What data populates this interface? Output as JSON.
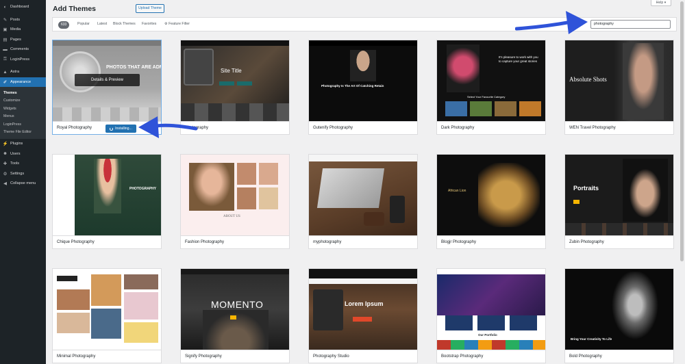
{
  "sidebar": {
    "items": [
      {
        "label": "Dashboard",
        "icon": "dashboard-icon",
        "glyph": "◐"
      },
      {
        "label": "Posts",
        "icon": "pin-icon",
        "glyph": "✎"
      },
      {
        "label": "Media",
        "icon": "media-icon",
        "glyph": "▣"
      },
      {
        "label": "Pages",
        "icon": "pages-icon",
        "glyph": "▤"
      },
      {
        "label": "Comments",
        "icon": "comments-icon",
        "glyph": "▬"
      },
      {
        "label": "LoginPress",
        "icon": "loginpress-icon",
        "glyph": "⚿"
      },
      {
        "label": "Astra",
        "icon": "astra-icon",
        "glyph": "▲"
      },
      {
        "label": "Appearance",
        "icon": "brush-icon",
        "glyph": "✐"
      }
    ],
    "appearance_sub": [
      "Themes",
      "Customize",
      "Widgets",
      "Menus",
      "LoginPress",
      "Theme File Editor"
    ],
    "items_after": [
      {
        "label": "Plugins",
        "icon": "plugins-icon",
        "glyph": "⚡"
      },
      {
        "label": "Users",
        "icon": "users-icon",
        "glyph": "☻"
      },
      {
        "label": "Tools",
        "icon": "tools-icon",
        "glyph": "✚"
      },
      {
        "label": "Settings",
        "icon": "settings-icon",
        "glyph": "⚙"
      }
    ],
    "collapse": "Collapse menu"
  },
  "header": {
    "title": "Add Themes",
    "upload_label": "Upload Theme",
    "help_label": "Help ▾"
  },
  "filter": {
    "count": "633",
    "links": [
      "Popular",
      "Latest",
      "Block Themes",
      "Favorites"
    ],
    "feature_filter": "Feature Filter",
    "search_value": "photography"
  },
  "installing": {
    "details_label": "Details & Preview",
    "installing_label": "Installing..."
  },
  "themes": [
    {
      "name": "Royal Photography",
      "headline": "PHOTOS THAT ARE ADMIRED YOU"
    },
    {
      "name": "Photography",
      "headline": "Site Title"
    },
    {
      "name": "Gutenify Photography",
      "headline": "Photography Is The Art Of Catching Retain"
    },
    {
      "name": "Dark Photography",
      "headline": "It's pleasure to work with you to capture your great stories",
      "sub": "Select Your Favourite Category"
    },
    {
      "name": "WEN Travel Photography",
      "headline": "Absolute Shots"
    },
    {
      "name": "Chique Photography",
      "headline": "PHOTOGRAPHY"
    },
    {
      "name": "Fashion Photography",
      "headline": "ABOUT US"
    },
    {
      "name": "myphotography",
      "headline": ""
    },
    {
      "name": "Blogjr Photography",
      "headline": "African Lion"
    },
    {
      "name": "Zubin Photography",
      "headline": "Portraits"
    },
    {
      "name": "Minimal Photography",
      "headline": ""
    },
    {
      "name": "Signify Photography",
      "headline": "MOMENTO"
    },
    {
      "name": "Photography Studio",
      "headline": "Lorem Ipsum"
    },
    {
      "name": "Bootstrap Photography",
      "headline": "Our Portfolio"
    },
    {
      "name": "Bold Photography",
      "headline": "Bring Your Creativity To Life"
    }
  ],
  "colors": {
    "accent": "#2271b1",
    "sidebar": "#1d2327",
    "arrow": "#2f53d9"
  }
}
